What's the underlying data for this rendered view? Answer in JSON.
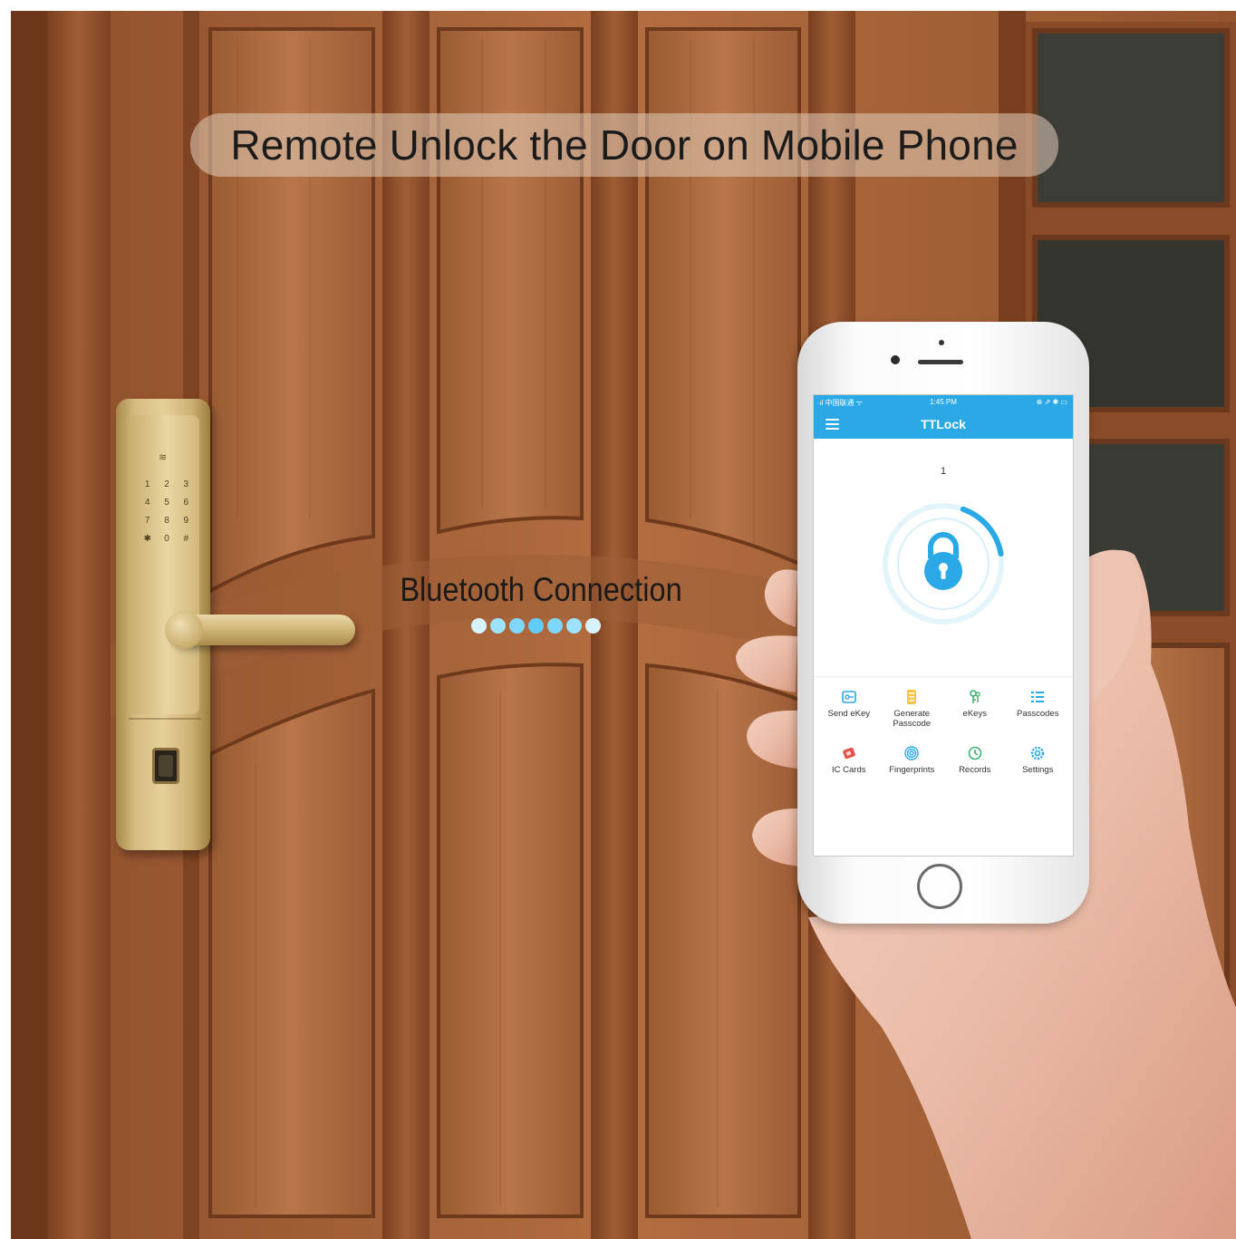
{
  "headline": "Remote Unlock the Door on Mobile Phone",
  "bluetooth": {
    "label": "Bluetooth Connection",
    "dot_colors": [
      "#d7f3ff",
      "#9de2ff",
      "#7fd7ff",
      "#63cdf9",
      "#7fd7ff",
      "#9de2ff",
      "#d7f3ff"
    ]
  },
  "lock": {
    "keys": [
      "1",
      "2",
      "3",
      "4",
      "5",
      "6",
      "7",
      "8",
      "9",
      "✱",
      "0",
      "#"
    ]
  },
  "phone": {
    "status_bar": {
      "carrier": "∙ıl 中国联通 ᯤ",
      "time": "1:45 PM",
      "icons": "⊕ ⇗ ✱ ▭"
    },
    "app_title": "TTLock",
    "lock_name": "1",
    "menu": [
      {
        "label": "Send eKey",
        "icon": "send-ekey-icon"
      },
      {
        "label": "Generate\nPasscode",
        "icon": "generate-passcode-icon"
      },
      {
        "label": "eKeys",
        "icon": "ekeys-icon"
      },
      {
        "label": "Passcodes",
        "icon": "passcodes-icon"
      },
      {
        "label": "IC Cards",
        "icon": "ic-cards-icon"
      },
      {
        "label": "Fingerprints",
        "icon": "fingerprints-icon"
      },
      {
        "label": "Records",
        "icon": "records-icon"
      },
      {
        "label": "Settings",
        "icon": "settings-icon"
      }
    ]
  },
  "colors": {
    "app_blue": "#2aa9e6",
    "door_wood": "#a8653a",
    "lock_gold": "#d4bb80"
  }
}
